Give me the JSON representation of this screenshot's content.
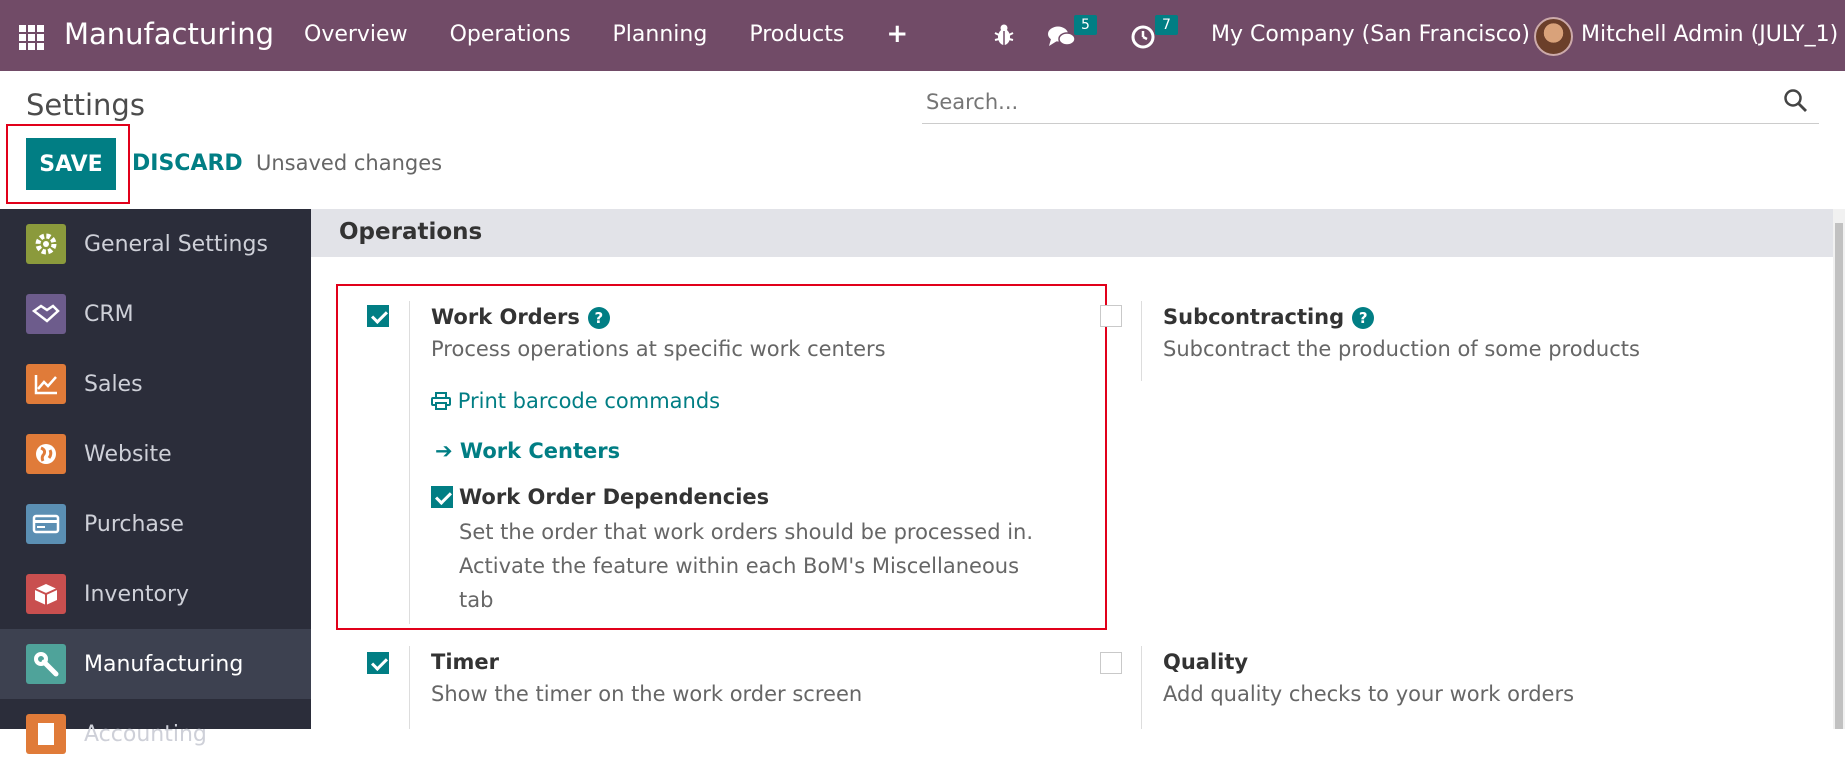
{
  "navbar": {
    "brand": "Manufacturing",
    "menu": [
      "Overview",
      "Operations",
      "Planning",
      "Products"
    ],
    "plus": "+",
    "messages_count": "5",
    "activities_count": "7",
    "company": "My Company (San Francisco)",
    "user": "Mitchell Admin (JULY_1)"
  },
  "control": {
    "title": "Settings",
    "search_placeholder": "Search...",
    "save": "SAVE",
    "discard": "DISCARD",
    "unsaved": "Unsaved changes"
  },
  "sidebar": {
    "items": [
      {
        "label": "General Settings",
        "icon": "gear-icon",
        "color": "#8b9a3c"
      },
      {
        "label": "CRM",
        "icon": "handshake-icon",
        "color": "#6d5c8c"
      },
      {
        "label": "Sales",
        "icon": "chart-icon",
        "color": "#e07b39"
      },
      {
        "label": "Website",
        "icon": "globe-icon",
        "color": "#e07b39"
      },
      {
        "label": "Purchase",
        "icon": "credit-card-icon",
        "color": "#5b8fb3"
      },
      {
        "label": "Inventory",
        "icon": "box-icon",
        "color": "#c94f4f"
      },
      {
        "label": "Manufacturing",
        "icon": "wrench-icon",
        "color": "#4fa39a"
      },
      {
        "label": "Accounting",
        "icon": "document-icon",
        "color": "#e07b39"
      }
    ]
  },
  "section": {
    "title": "Operations",
    "work_orders": {
      "title": "Work Orders",
      "checked": true,
      "desc": "Process operations at specific work centers",
      "print_link": "Print barcode commands",
      "work_centers_link": "Work Centers",
      "dependencies": {
        "title": "Work Order Dependencies",
        "checked": true,
        "desc_lines": [
          "Set the order that work orders should be processed in.",
          "Activate the feature within each BoM's Miscellaneous",
          "tab"
        ]
      }
    },
    "subcontracting": {
      "title": "Subcontracting",
      "checked": false,
      "desc": "Subcontract the production of some products"
    },
    "timer": {
      "title": "Timer",
      "checked": true,
      "desc": "Show the timer on the work order screen"
    },
    "quality": {
      "title": "Quality",
      "checked": false,
      "desc": "Add quality checks to your work orders"
    }
  }
}
